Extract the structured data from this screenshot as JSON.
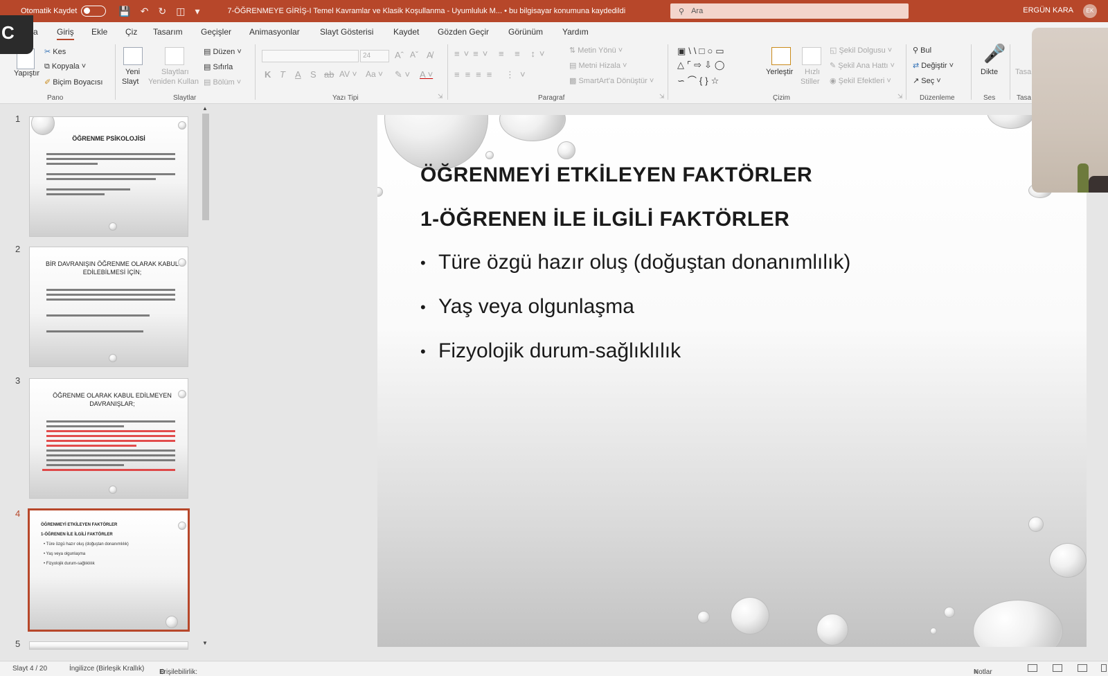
{
  "titlebar": {
    "autosave_label": "Otomatik Kaydet",
    "document_title": "7-ÖĞRENMEYE GİRİŞ-I Temel Kavramlar ve Klasik Koşullanma  -  Uyumluluk M...  •  bu bilgisayar konumuna kaydedildi",
    "search_placeholder": "Ara",
    "user_name": "ERGÜN KARA",
    "user_initials": "EK"
  },
  "overlay_letter": "C",
  "menu": {
    "tabs": [
      "a",
      "Giriş",
      "Ekle",
      "Çiz",
      "Tasarım",
      "Geçişler",
      "Animasyonlar",
      "Slayt Gösterisi",
      "Kaydet",
      "Gözden Geçir",
      "Görünüm",
      "Yardım"
    ]
  },
  "ribbon": {
    "pano": {
      "paste": "Yapıştır",
      "cut": "Kes",
      "copy": "Kopyala",
      "format_painter": "Biçim Boyacısı",
      "label": "Pano"
    },
    "slaytlar": {
      "new_slide_1": "Yeni",
      "new_slide_2": "Slayt",
      "reuse_1": "Slaytları",
      "reuse_2": "Yeniden Kullan",
      "layout": "Düzen",
      "reset": "Sıfırla",
      "section": "Bölüm",
      "label": "Slaytlar"
    },
    "yazi_tipi": {
      "font_size": "24",
      "bold": "K",
      "italic": "T",
      "underline": "A",
      "shadow": "S",
      "label": "Yazı Tipi"
    },
    "paragraf": {
      "text_direction": "Metin Yönü",
      "align_text": "Metni Hizala",
      "smartart": "SmartArt'a Dönüştür",
      "label": "Paragraf"
    },
    "cizim": {
      "arrange": "Yerleştir",
      "quick_styles_1": "Hızlı",
      "quick_styles_2": "Stiller",
      "shape_fill": "Şekil Dolgusu",
      "shape_outline": "Şekil Ana Hattı",
      "shape_effects": "Şekil Efektleri",
      "label": "Çizim"
    },
    "duzenleme": {
      "find": "Bul",
      "replace": "Değiştir",
      "select": "Seç",
      "label": "Düzenleme"
    },
    "ses": {
      "dictate": "Dikte",
      "label": "Ses"
    },
    "tasarimci": {
      "btn": "Tasa",
      "label": "Tasa"
    }
  },
  "thumbnails": [
    {
      "num": "1",
      "title": "ÖĞRENME PSİKOLOJİSİ"
    },
    {
      "num": "2",
      "title": "BİR DAVRANIŞIN ÖĞRENME OLARAK KABUL EDİLEBİLMESİ İÇİN;"
    },
    {
      "num": "3",
      "title": "ÖĞRENME OLARAK KABUL EDİLMEYEN DAVRANIŞLAR;"
    },
    {
      "num": "4",
      "title": "ÖĞRENMEYİ ETKİLEYEN FAKTÖRLER",
      "subtitle": "1-ÖĞRENEN İLE İLGİLİ FAKTÖRLER",
      "bullets": [
        "Türe özgü hazır oluş (doğuştan donanımlılık)",
        "Yaş veya olgunlaşma",
        "Fizyolojik durum-sağlıklılık"
      ]
    },
    {
      "num": "5"
    }
  ],
  "slide": {
    "title": "ÖĞRENMEYİ ETKİLEYEN FAKTÖRLER",
    "subtitle": "1-ÖĞRENEN İLE İLGİLİ FAKTÖRLER",
    "bullets": [
      "Türe özgü hazır oluş (doğuştan donanımlılık)",
      "Yaş veya olgunlaşma",
      "Fizyolojik durum-sağlıklılık"
    ]
  },
  "statusbar": {
    "slide_counter": "Slayt 4 / 20",
    "language": "İngilizce (Birleşik Krallık)",
    "accessibility": "Erişilebilirlik: Kullanılamaz",
    "notes": "Notlar"
  }
}
